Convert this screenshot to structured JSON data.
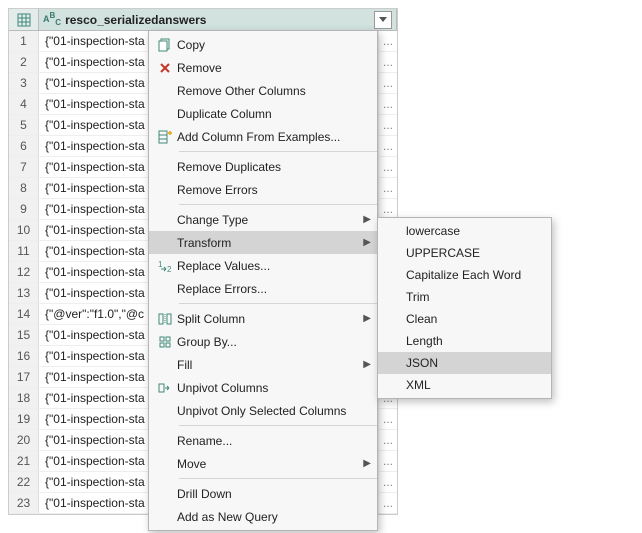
{
  "column": {
    "name": "resco_serializedanswers",
    "type_label": "ABC"
  },
  "rows": [
    {
      "n": "1",
      "v": "{\"01-inspection-sta"
    },
    {
      "n": "2",
      "v": "{\"01-inspection-sta"
    },
    {
      "n": "3",
      "v": "{\"01-inspection-sta"
    },
    {
      "n": "4",
      "v": "{\"01-inspection-sta"
    },
    {
      "n": "5",
      "v": "{\"01-inspection-sta"
    },
    {
      "n": "6",
      "v": "{\"01-inspection-sta"
    },
    {
      "n": "7",
      "v": "{\"01-inspection-sta"
    },
    {
      "n": "8",
      "v": "{\"01-inspection-sta"
    },
    {
      "n": "9",
      "v": "{\"01-inspection-sta"
    },
    {
      "n": "10",
      "v": "{\"01-inspection-sta"
    },
    {
      "n": "11",
      "v": "{\"01-inspection-sta"
    },
    {
      "n": "12",
      "v": "{\"01-inspection-sta"
    },
    {
      "n": "13",
      "v": "{\"01-inspection-sta"
    },
    {
      "n": "14",
      "v": "{\"@ver\":\"f1.0\",\"@c"
    },
    {
      "n": "15",
      "v": "{\"01-inspection-sta"
    },
    {
      "n": "16",
      "v": "{\"01-inspection-sta"
    },
    {
      "n": "17",
      "v": "{\"01-inspection-sta"
    },
    {
      "n": "18",
      "v": "{\"01-inspection-sta"
    },
    {
      "n": "19",
      "v": "{\"01-inspection-sta"
    },
    {
      "n": "20",
      "v": "{\"01-inspection-sta"
    },
    {
      "n": "21",
      "v": "{\"01-inspection-sta"
    },
    {
      "n": "22",
      "v": "{\"01-inspection-sta"
    },
    {
      "n": "23",
      "v": "{\"01-inspection-sta"
    }
  ],
  "ellipsis": "...",
  "menu": {
    "copy": "Copy",
    "remove": "Remove",
    "remove_other": "Remove Other Columns",
    "duplicate": "Duplicate Column",
    "add_from_examples": "Add Column From Examples...",
    "remove_dup": "Remove Duplicates",
    "remove_err": "Remove Errors",
    "change_type": "Change Type",
    "transform": "Transform",
    "replace_values": "Replace Values...",
    "replace_errors": "Replace Errors...",
    "split_column": "Split Column",
    "group_by": "Group By...",
    "fill": "Fill",
    "unpivot": "Unpivot Columns",
    "unpivot_sel": "Unpivot Only Selected Columns",
    "rename": "Rename...",
    "move": "Move",
    "drill": "Drill Down",
    "add_new_query": "Add as New Query"
  },
  "submenu": {
    "lowercase": "lowercase",
    "uppercase": "UPPERCASE",
    "capitalize": "Capitalize Each Word",
    "trim": "Trim",
    "clean": "Clean",
    "length": "Length",
    "json": "JSON",
    "xml": "XML"
  }
}
